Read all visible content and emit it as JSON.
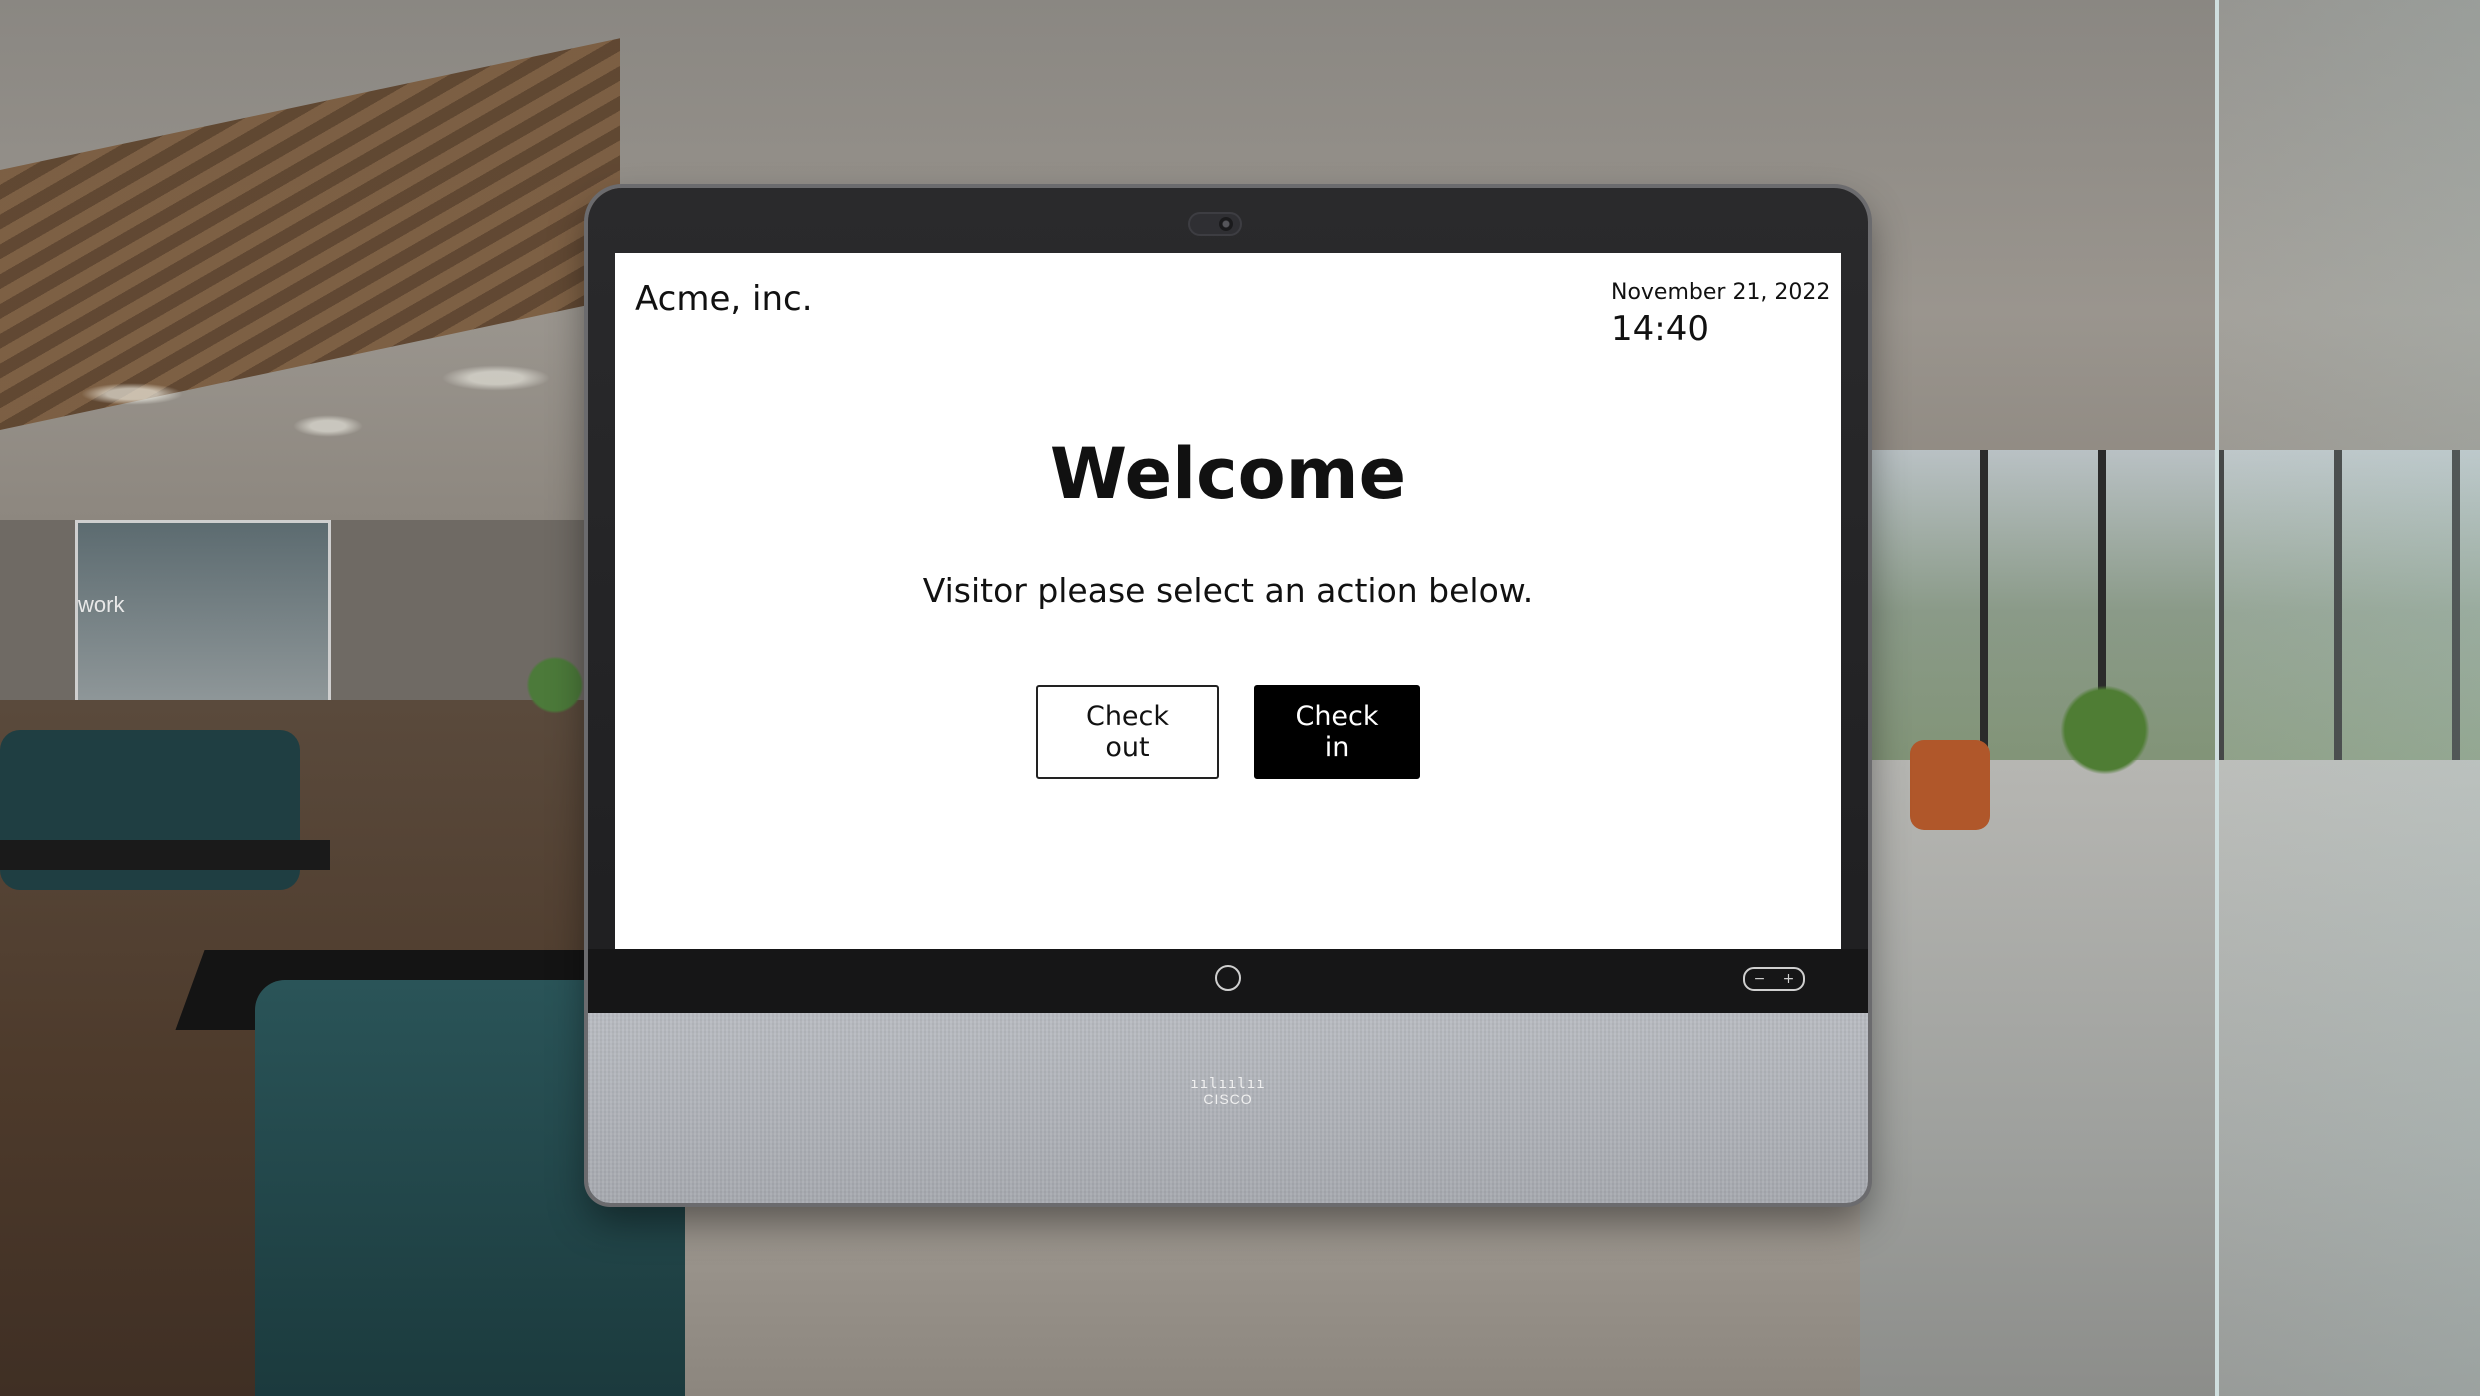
{
  "header": {
    "company_name": "Acme, inc.",
    "date": "November 21, 2022",
    "time": "14:40"
  },
  "main": {
    "title": "Welcome",
    "subtitle": "Visitor please select an action below.",
    "buttons": {
      "check_out_label": "Check out",
      "check_in_label": "Check in"
    }
  },
  "device": {
    "brand": "CISCO",
    "volume": {
      "minus": "−",
      "plus": "+"
    }
  },
  "background": {
    "wall_text": "work"
  },
  "colors": {
    "screen_bg": "#ffffff",
    "primary_button_bg": "#000000",
    "primary_button_text": "#ffffff",
    "text": "#111111"
  },
  "icons": [
    "camera-icon",
    "home-icon",
    "volume-icon",
    "cisco-logo"
  ]
}
